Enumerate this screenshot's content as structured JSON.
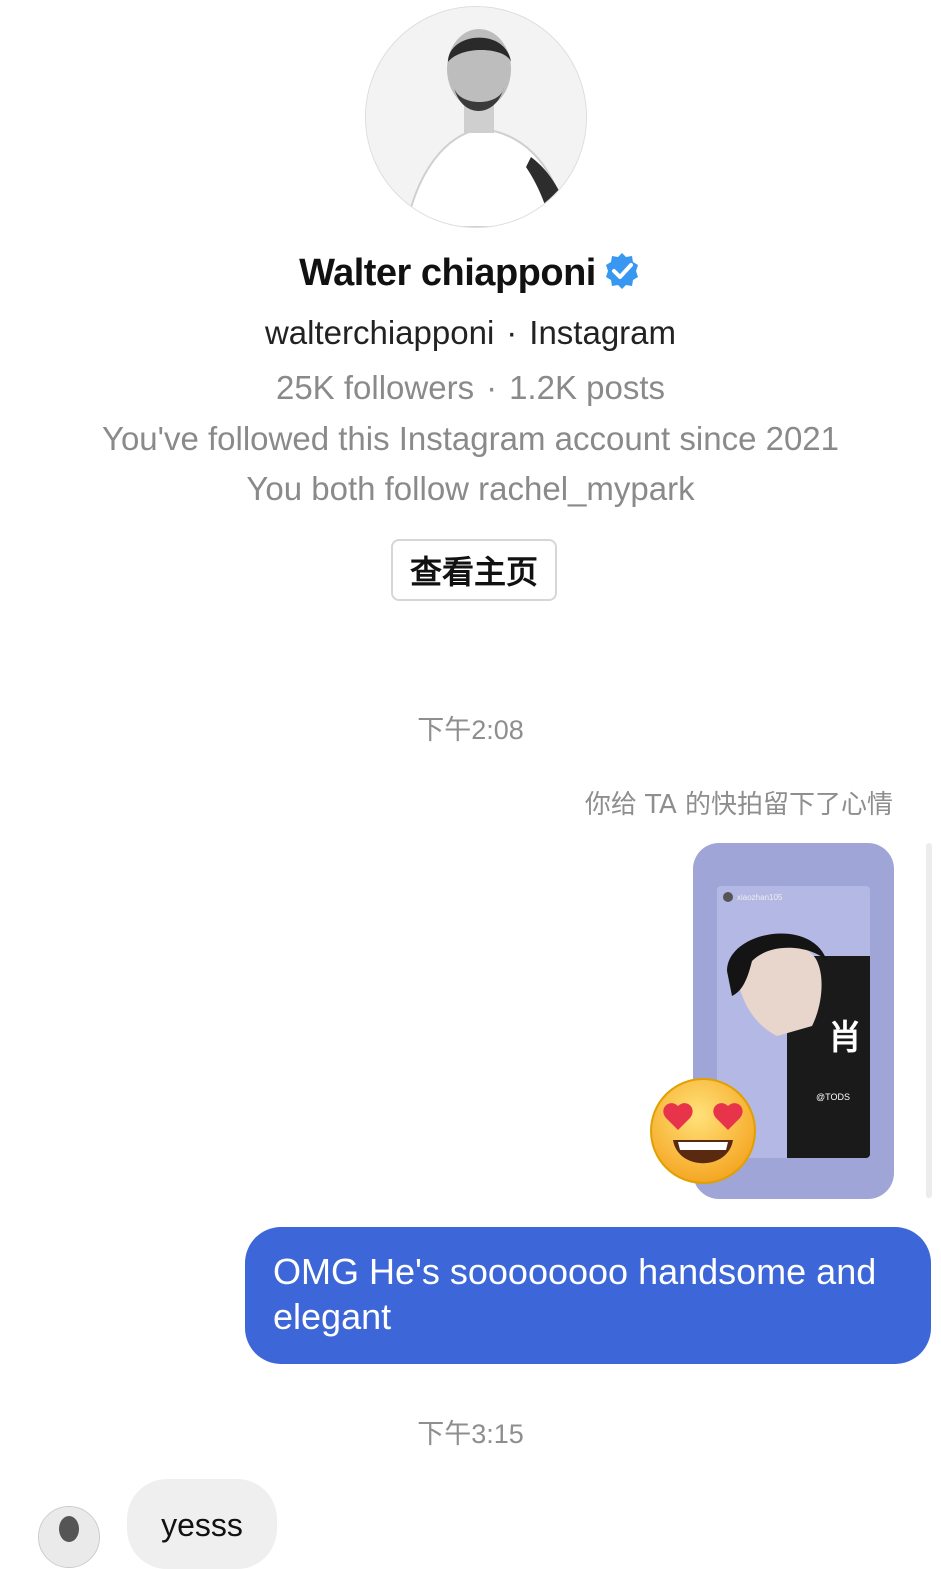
{
  "profile": {
    "name": "Walter chiapponi",
    "verified": true,
    "handle": "walterchiapponi",
    "platform": "Instagram",
    "followers": "25K followers",
    "posts": "1.2K posts",
    "followed_since": "You've followed this Instagram account since 2021",
    "mutual": "You both follow rachel_mypark",
    "view_profile_label": "查看主页"
  },
  "conversation": {
    "timestamp_1": "下午2:08",
    "reaction_note": "你给 TA 的快拍留下了心情",
    "story": {
      "username": "xiaozhan105",
      "character": "肖",
      "tag": "@TODS",
      "reaction_emoji": "heart-eyes"
    },
    "outgoing_message": "OMG He's soooooooo handsome and elegant",
    "timestamp_2": "下午3:15",
    "incoming_message": "yesss"
  },
  "colors": {
    "accent_blue": "#3d67d8",
    "verified_blue": "#3897f0",
    "muted_text": "#8a8a8a",
    "story_bg": "#9fa5d6"
  }
}
